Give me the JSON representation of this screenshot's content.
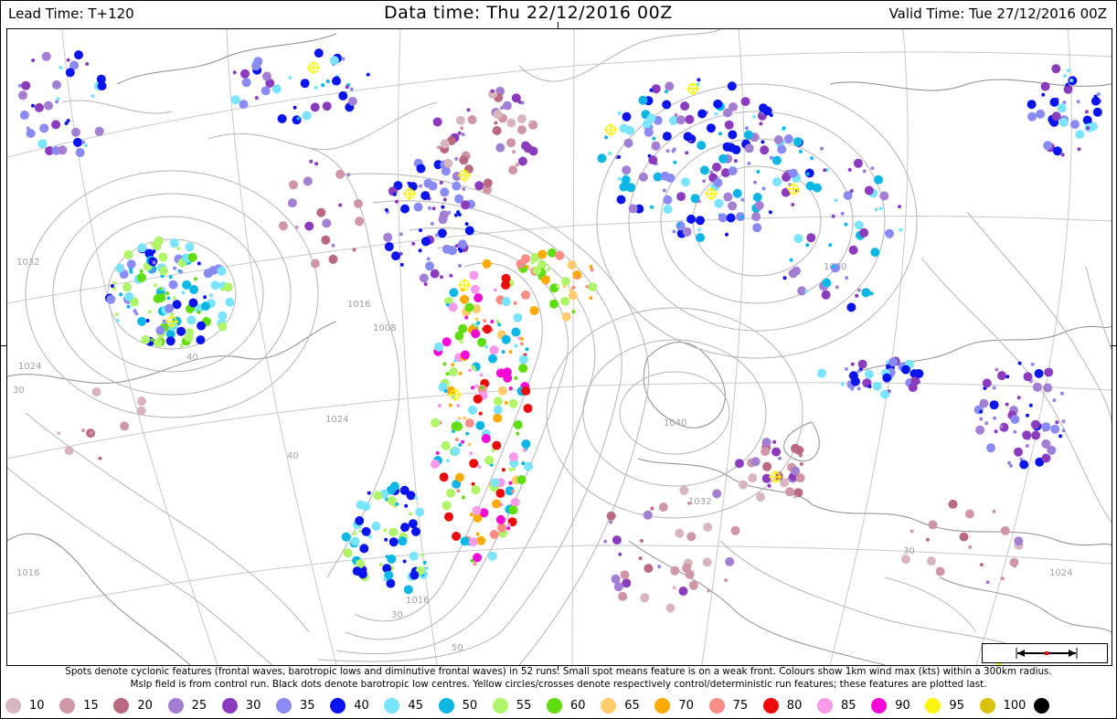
{
  "header": {
    "lead_time": "Lead Time: T+120",
    "data_time": "Data time:  Thu 22/12/2016 00Z",
    "valid_time": "Valid Time: Tue 27/12/2016 00Z"
  },
  "note": {
    "line1": "Spots denote cyclonic features (frontal waves, barotropic lows and diminutive frontal waves) in 52 runs. Small spot means feature is on a weak front. Colours show 1km wind max (kts) within a 300km radius.",
    "line2": "Mslp field is from control run. Black dots denote barotropic low centres. Yellow circles/crosses denote respectively control/deterministic run features; these features are plotted last."
  },
  "legend": [
    {
      "label": "10",
      "color": "#d7b6bd"
    },
    {
      "label": "15",
      "color": "#cf96a5"
    },
    {
      "label": "20",
      "color": "#b96a80"
    },
    {
      "label": "25",
      "color": "#a27fd3"
    },
    {
      "label": "30",
      "color": "#8a3cbd"
    },
    {
      "label": "35",
      "color": "#8a8af5"
    },
    {
      "label": "40",
      "color": "#0a14ee"
    },
    {
      "label": "45",
      "color": "#79e4fb"
    },
    {
      "label": "50",
      "color": "#0cb7e6"
    },
    {
      "label": "55",
      "color": "#b0f46a"
    },
    {
      "label": "60",
      "color": "#5fdd0f"
    },
    {
      "label": "65",
      "color": "#ffcb6b"
    },
    {
      "label": "70",
      "color": "#ffaa00"
    },
    {
      "label": "75",
      "color": "#fb8c86"
    },
    {
      "label": "80",
      "color": "#ee0a0a"
    },
    {
      "label": "85",
      "color": "#f79ae9"
    },
    {
      "label": "90",
      "color": "#f50ad6"
    },
    {
      "label": "95",
      "color": "#fbf40c"
    },
    {
      "label": "100",
      "color": "#dbc20c"
    },
    {
      "label": "",
      "color": "#000000"
    }
  ],
  "isobar_labels": [
    "1032",
    "1024",
    "1016",
    "1008",
    "1000",
    "1040",
    "1024",
    "1016",
    "1024",
    "1032",
    "1024",
    "1016"
  ],
  "latitude_labels": [
    "30",
    "40",
    "50",
    "30",
    "40",
    "30",
    "40",
    "30"
  ]
}
